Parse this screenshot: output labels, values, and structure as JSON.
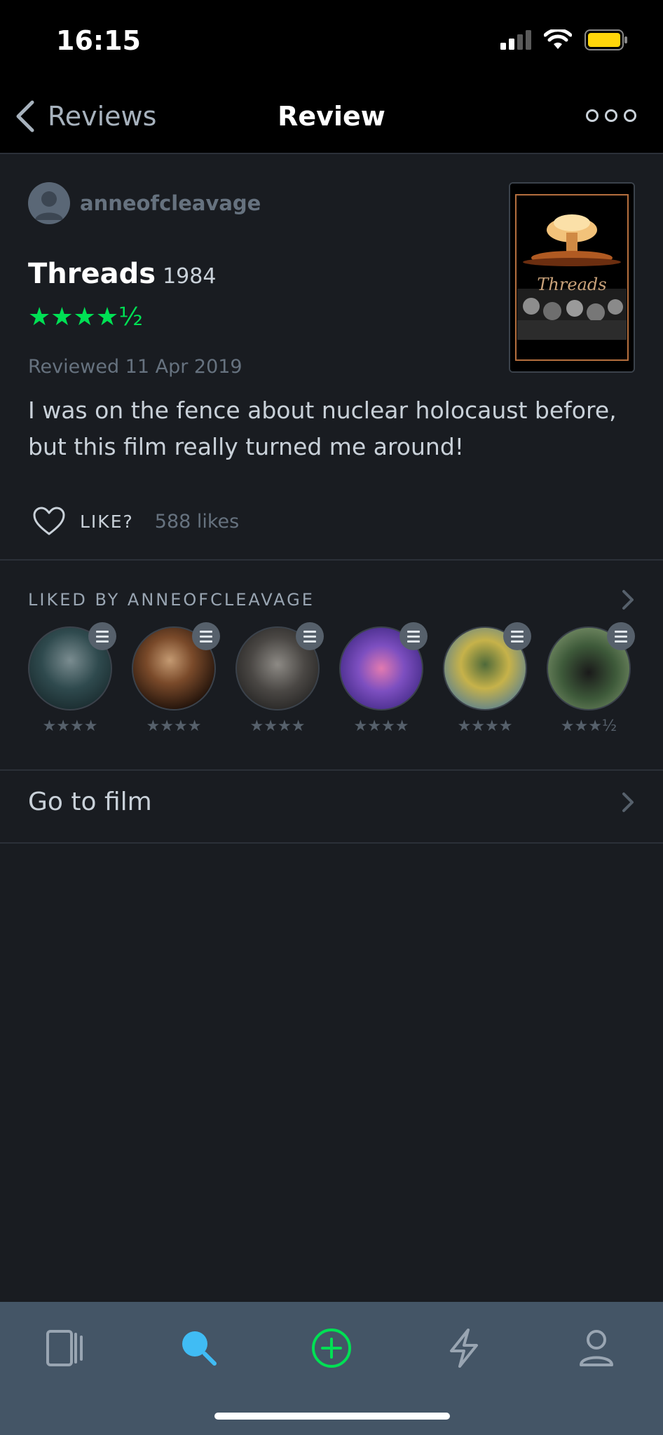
{
  "status_bar": {
    "time": "16:15"
  },
  "nav": {
    "back_label": "Reviews",
    "title": "Review"
  },
  "review": {
    "author": "anneofcleavage",
    "film_title": "Threads",
    "film_year": "1984",
    "rating": "★★★★½",
    "rating_value": 4.5,
    "reviewed_date": "Reviewed 11 Apr 2019",
    "text": "I was on the fence about nuclear holocaust before, but this film really turned me around!",
    "like_label": "LIKE?",
    "likes_count": "588 likes",
    "poster_title": "Threads"
  },
  "liked_by": {
    "title": "LIKED BY ANNEOFCLEAVAGE",
    "items": [
      {
        "rating": "★★★★"
      },
      {
        "rating": "★★★★"
      },
      {
        "rating": "★★★★"
      },
      {
        "rating": "★★★★"
      },
      {
        "rating": "★★★★"
      },
      {
        "rating": "★★★½"
      }
    ]
  },
  "goto_film": {
    "label": "Go to film"
  },
  "tabbar": {
    "items": [
      {
        "icon": "films-icon"
      },
      {
        "icon": "search-icon",
        "active": true
      },
      {
        "icon": "add-icon"
      },
      {
        "icon": "activity-icon"
      },
      {
        "icon": "profile-icon"
      }
    ]
  },
  "colors": {
    "background": "#191c21",
    "accent_green": "#00e054",
    "accent_blue": "#40bcf4",
    "tabbar": "#445566",
    "muted": "#66727f"
  }
}
